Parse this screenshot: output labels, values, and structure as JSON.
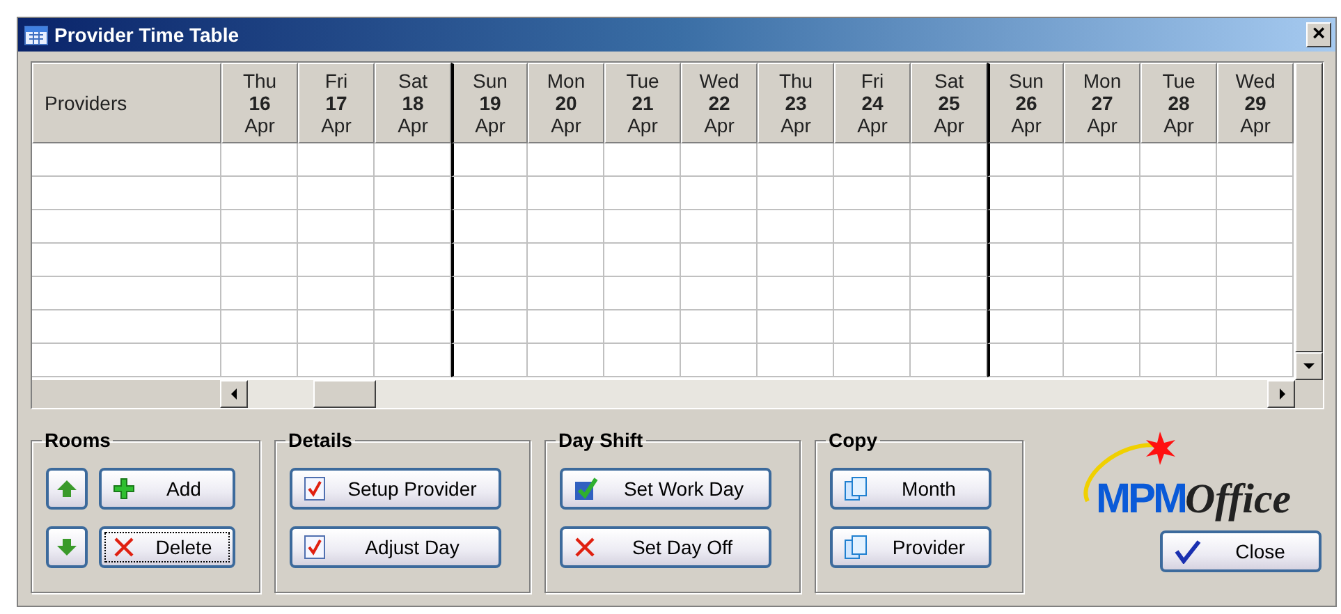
{
  "window": {
    "title": "Provider Time Table",
    "close": "×"
  },
  "table": {
    "first_column": "Providers",
    "columns": [
      {
        "weekday": "Thu",
        "date": "16",
        "month": "Apr",
        "week_start": false
      },
      {
        "weekday": "Fri",
        "date": "17",
        "month": "Apr",
        "week_start": false
      },
      {
        "weekday": "Sat",
        "date": "18",
        "month": "Apr",
        "week_start": false
      },
      {
        "weekday": "Sun",
        "date": "19",
        "month": "Apr",
        "week_start": true
      },
      {
        "weekday": "Mon",
        "date": "20",
        "month": "Apr",
        "week_start": false
      },
      {
        "weekday": "Tue",
        "date": "21",
        "month": "Apr",
        "week_start": false
      },
      {
        "weekday": "Wed",
        "date": "22",
        "month": "Apr",
        "week_start": false
      },
      {
        "weekday": "Thu",
        "date": "23",
        "month": "Apr",
        "week_start": false
      },
      {
        "weekday": "Fri",
        "date": "24",
        "month": "Apr",
        "week_start": false
      },
      {
        "weekday": "Sat",
        "date": "25",
        "month": "Apr",
        "week_start": false
      },
      {
        "weekday": "Sun",
        "date": "26",
        "month": "Apr",
        "week_start": true
      },
      {
        "weekday": "Mon",
        "date": "27",
        "month": "Apr",
        "week_start": false
      },
      {
        "weekday": "Tue",
        "date": "28",
        "month": "Apr",
        "week_start": false
      },
      {
        "weekday": "Wed",
        "date": "29",
        "month": "Apr",
        "week_start": false
      }
    ]
  },
  "groups": [
    {
      "title": "Rooms",
      "buttons": [
        {
          "focused": false
        },
        {
          "label": "Add",
          "focused": false
        },
        {
          "focused": false
        },
        {
          "label": "Delete",
          "focused": true
        }
      ]
    },
    {
      "title": "Details",
      "buttons": [
        {
          "label": "Setup Provider",
          "focused": false
        },
        {
          "label": "Adjust Day",
          "focused": false
        }
      ]
    },
    {
      "title": "Day Shift",
      "buttons": [
        {
          "label": "Set Work Day",
          "focused": false
        },
        {
          "label": "Set Day Off",
          "focused": false
        }
      ]
    },
    {
      "title": "Copy",
      "buttons": [
        {
          "label": "Month",
          "focused": false
        },
        {
          "label": "Provider",
          "focused": false
        }
      ]
    }
  ],
  "logo": {
    "first": "MPM",
    "second": "Office"
  },
  "close_button": {
    "label": "Close"
  }
}
